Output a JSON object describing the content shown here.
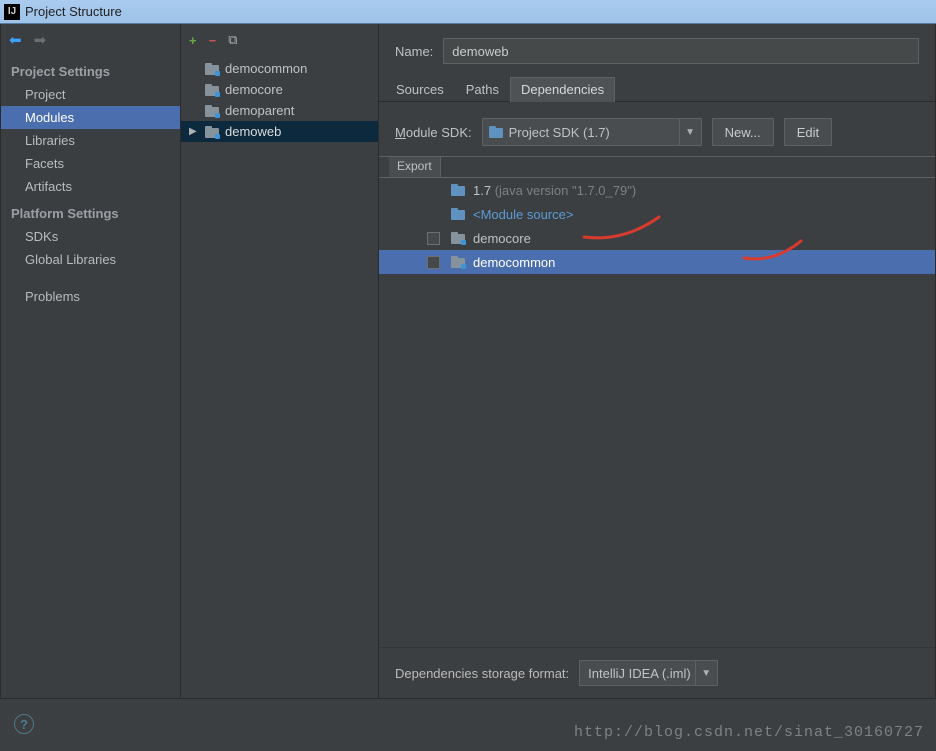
{
  "window": {
    "title": "Project Structure"
  },
  "sidebar": {
    "section1_title": "Project Settings",
    "section1": [
      "Project",
      "Modules",
      "Libraries",
      "Facets",
      "Artifacts"
    ],
    "selected1": 1,
    "section2_title": "Platform Settings",
    "section2": [
      "SDKs",
      "Global Libraries"
    ],
    "extra": [
      "Problems"
    ]
  },
  "modules": {
    "items": [
      "democommon",
      "democore",
      "demoparent",
      "demoweb"
    ],
    "selected": 3
  },
  "details": {
    "name_label": "Name:",
    "name_value": "demoweb",
    "tabs": [
      "Sources",
      "Paths",
      "Dependencies"
    ],
    "active_tab": 2,
    "sdk_label_pre": "M",
    "sdk_label_rest": "odule SDK:",
    "sdk_selected": "Project SDK (1.7)",
    "btn_new": "New...",
    "btn_edit": "Edit",
    "export_header": "Export",
    "deps": [
      {
        "check": null,
        "name": "1.7",
        "suffix": " (java version \"1.7.0_79\")",
        "icon": "sdk"
      },
      {
        "check": null,
        "name": "<Module source>",
        "link": true,
        "icon": "folder"
      },
      {
        "check": false,
        "name": "democore",
        "icon": "module"
      },
      {
        "check": false,
        "name": "democommon",
        "icon": "module"
      }
    ],
    "selected_dep": 3,
    "storage_label": "Dependencies storage format:",
    "storage_value": "IntelliJ IDEA (.iml)"
  },
  "watermark": "http://blog.csdn.net/sinat_30160727"
}
